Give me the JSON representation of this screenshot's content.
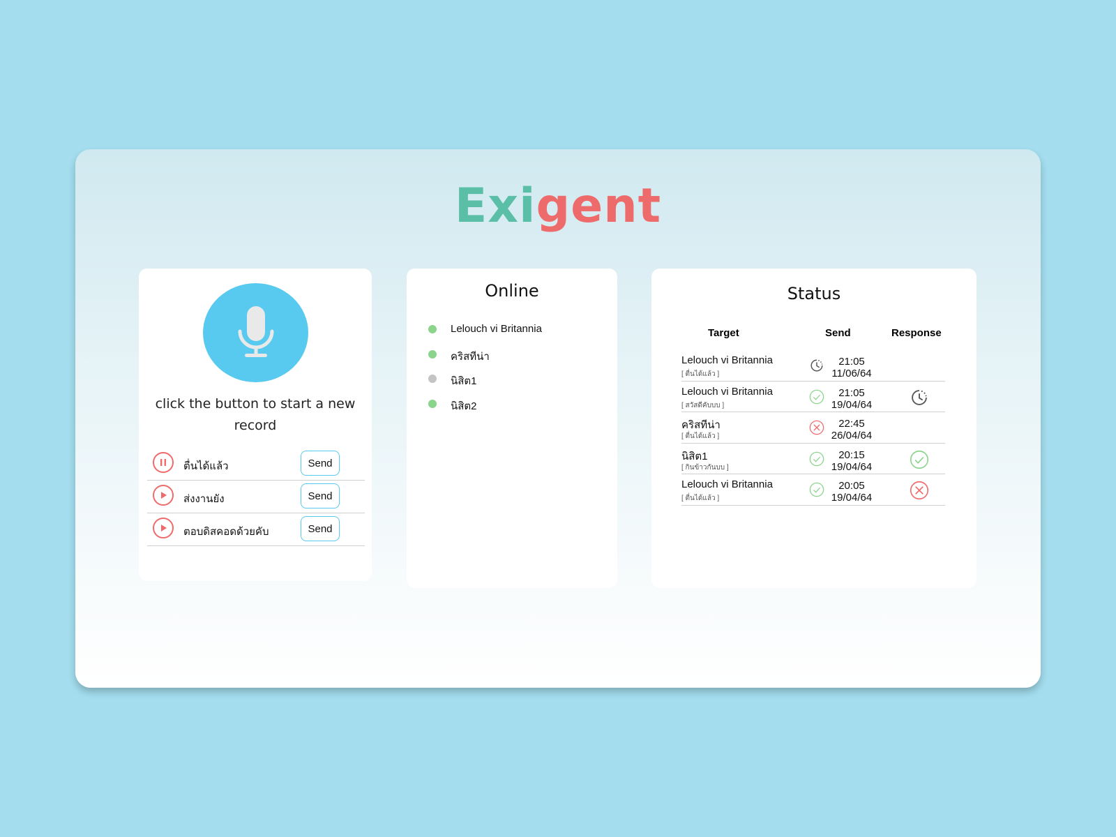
{
  "logo": {
    "part1": "Exi",
    "part2": "gent",
    "color1": "#5bbfa8",
    "color2": "#ee6b6b"
  },
  "recorder": {
    "mic_icon": "microphone-icon",
    "hint": "click the button to start a new record",
    "records": [
      {
        "state": "pause",
        "label": "ตื่นได้แล้ว",
        "send_label": "Send"
      },
      {
        "state": "play",
        "label": "ส่งงานยัง",
        "send_label": "Send"
      },
      {
        "state": "play",
        "label": "ตอบดิสคอดด้วยคับ",
        "send_label": "Send"
      }
    ]
  },
  "online": {
    "title": "Online",
    "users": [
      {
        "name": "Lelouch vi Britannia",
        "status": "online"
      },
      {
        "name": "คริสทีน่า",
        "status": "online"
      },
      {
        "name": "นิสิต1",
        "status": "offline"
      },
      {
        "name": "นิสิต2",
        "status": "online"
      }
    ]
  },
  "status": {
    "title": "Status",
    "headers": {
      "target": "Target",
      "send": "Send",
      "response": "Response"
    },
    "rows": [
      {
        "target": "Lelouch vi Britannia",
        "message": "[ ตื่นได้แล้ว ]",
        "send_status": "pending",
        "time": "21:05",
        "date": "11/06/64",
        "response": "none"
      },
      {
        "target": "Lelouch vi Britannia",
        "message": "[ สวัสดีคับบบ ]",
        "send_status": "success",
        "time": "21:05",
        "date": "19/04/64",
        "response": "pending"
      },
      {
        "target": "คริสทีน่า",
        "message": "[ ตื่นได้แล้ว ]",
        "send_status": "failed",
        "time": "22:45",
        "date": "26/04/64",
        "response": "none"
      },
      {
        "target": "นิสิต1",
        "message": "[ กินข้าวกันบบ ]",
        "send_status": "success",
        "time": "20:15",
        "date": "19/04/64",
        "response": "success"
      },
      {
        "target": "Lelouch vi Britannia",
        "message": "[ ตื่นได้แล้ว ]",
        "send_status": "success",
        "time": "20:05",
        "date": "19/04/64",
        "response": "failed"
      }
    ]
  },
  "colors": {
    "accent": "#58c9ef",
    "danger": "#ef6b6b",
    "success": "#8bd48b",
    "offline": "#c4c4c4",
    "pending": "#555555"
  }
}
